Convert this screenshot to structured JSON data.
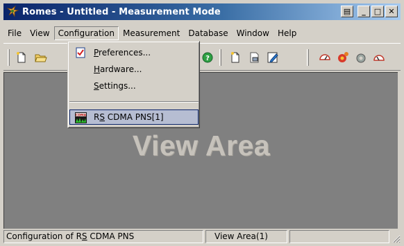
{
  "window": {
    "title": "Romes - Untitled - Measurement Mode",
    "controls": {
      "restore": "▤",
      "minimize": "_",
      "maximize": "□",
      "close": "✕"
    }
  },
  "menubar": {
    "items": [
      "File",
      "View",
      "Configuration",
      "Measurement",
      "Database",
      "Window",
      "Help"
    ],
    "active": "Configuration"
  },
  "config_menu": {
    "preferences": {
      "pre": "",
      "key": "P",
      "post": "references..."
    },
    "hardware": {
      "pre": "",
      "key": "H",
      "post": "ardware..."
    },
    "settings": {
      "pre": "",
      "key": "S",
      "post": "ettings..."
    },
    "rs_cdma": {
      "pre": "R",
      "key": "S",
      "post": " CDMA PNS[1]"
    },
    "cdma_icon_text": "CDMA"
  },
  "view": {
    "label": "View Area"
  },
  "statusbar": {
    "message_pre": "Configuration of R",
    "message_key": "S",
    "message_post": " CDMA PNS",
    "pane2": "View Area(1)"
  },
  "colors": {
    "title_start": "#0a246a",
    "title_end": "#a6caf0",
    "face": "#d4d0c8",
    "view_bg": "#808080",
    "highlight_bg": "#b6bdd2",
    "highlight_border": "#0a246a"
  }
}
